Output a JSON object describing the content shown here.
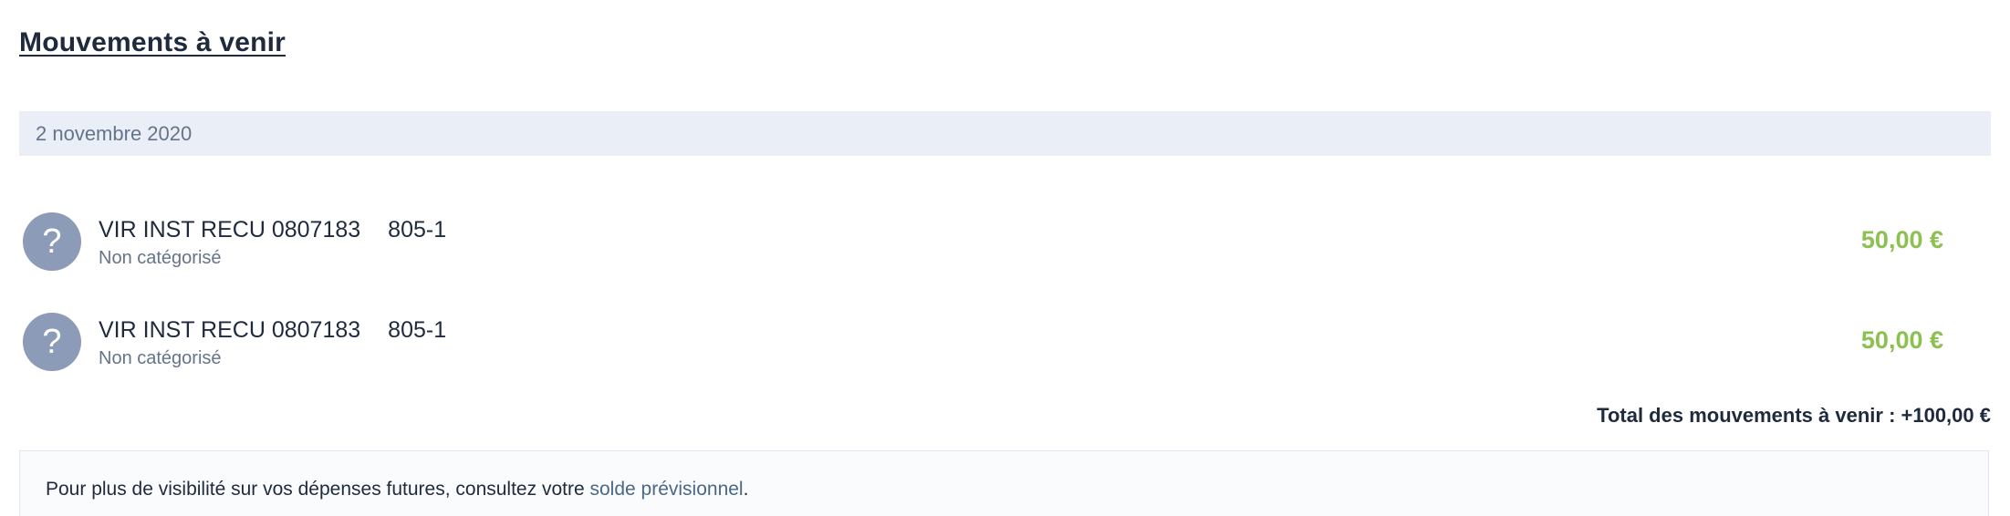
{
  "section": {
    "title": "Mouvements à venir"
  },
  "date_group": {
    "label": "2 novembre 2020"
  },
  "transactions": [
    {
      "icon": "question-mark-icon",
      "icon_glyph": "?",
      "label_start": "VIR INST RECU 0807183",
      "label_end": "805-1",
      "category": "Non catégorisé",
      "amount": "50,00 €"
    },
    {
      "icon": "question-mark-icon",
      "icon_glyph": "?",
      "label_start": "VIR INST RECU 0807183",
      "label_end": "805-1",
      "category": "Non catégorisé",
      "amount": "50,00 €"
    }
  ],
  "total": {
    "text": "Total des mouvements à venir : +100,00 €"
  },
  "info": {
    "text_before": "Pour plus de visibilité sur vos dépenses futures, consultez votre ",
    "link_label": "solde prévisionnel",
    "text_after": "."
  },
  "colors": {
    "positive_amount": "#8cc152",
    "avatar_bg": "#8b9bb8",
    "date_band_bg": "#eaeff7",
    "link": "#4a6785"
  }
}
